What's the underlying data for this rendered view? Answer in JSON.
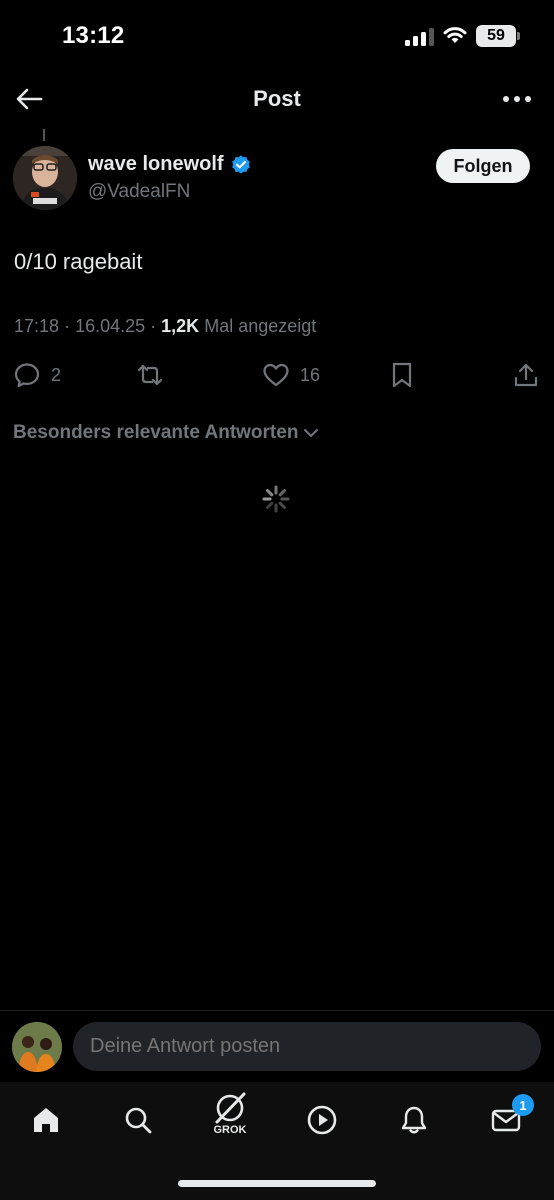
{
  "status_bar": {
    "time": "13:12",
    "battery": "59"
  },
  "header": {
    "title": "Post"
  },
  "post": {
    "author_name": "wave lonewolf",
    "author_handle": "@VadealFN",
    "follow_label": "Folgen",
    "text": "0/10 ragebait",
    "time": "17:18",
    "date": "16.04.25",
    "views": "1,2K",
    "views_label": "Mal angezeigt",
    "replies": "2",
    "likes": "16"
  },
  "replies_sort": {
    "label": "Besonders relevante Antworten"
  },
  "composer": {
    "placeholder": "Deine Antwort posten"
  },
  "nav": {
    "grok_label": "GROK",
    "messages_badge": "1",
    "items": [
      "home-icon",
      "search-icon",
      "grok-icon",
      "video-icon",
      "bell-icon",
      "mail-icon"
    ]
  },
  "colors": {
    "accent": "#1d9bf0",
    "background": "#000000",
    "muted": "#71767b",
    "text": "#e7e9ea"
  }
}
